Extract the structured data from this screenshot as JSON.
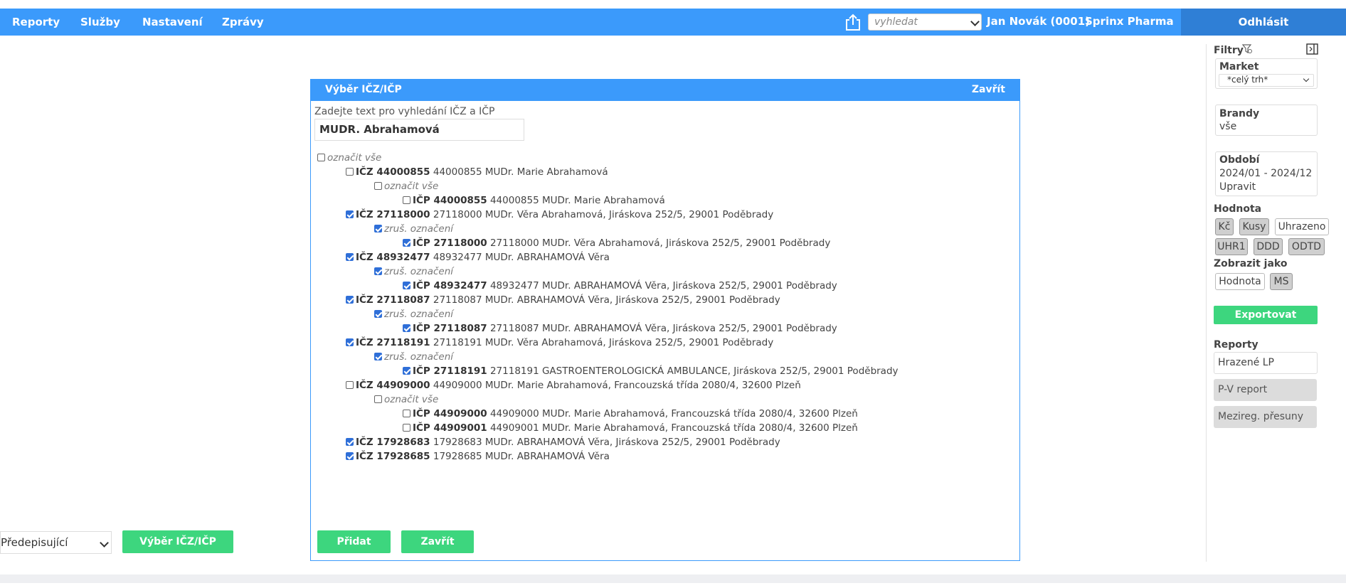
{
  "topbar": {
    "nav": [
      "Reporty",
      "Služby",
      "Nastavení",
      "Zprávy"
    ],
    "search_placeholder": "vyhledat",
    "user": "Jan Novák (0001)",
    "company": "Sprinx Pharma",
    "logout": "Odhlásit"
  },
  "modal": {
    "title": "Výběr IČZ/IČP",
    "close_link": "Zavřít",
    "search_label": "Zadejte text pro vyhledání IČZ a IČP",
    "search_value": "MUDR. Abrahamová",
    "select_all": "označit vše",
    "tree": [
      {
        "level": 1,
        "kind": "item",
        "checked": false,
        "code": "IČZ 44000855",
        "text": "44000855 MUDr. Marie Abrahamová"
      },
      {
        "level": 2,
        "kind": "mark",
        "checked": false,
        "text": "označit vše"
      },
      {
        "level": 3,
        "kind": "item",
        "checked": false,
        "code": "IČP 44000855",
        "text": "44000855 MUDr. Marie Abrahamová"
      },
      {
        "level": 1,
        "kind": "item",
        "checked": true,
        "code": "IČZ 27118000",
        "text": "27118000 MUDr. Věra Abrahamová, Jiráskova 252/5, 29001 Poděbrady"
      },
      {
        "level": 2,
        "kind": "mark",
        "checked": true,
        "text": "zruš. označení"
      },
      {
        "level": 3,
        "kind": "item",
        "checked": true,
        "code": "IČP 27118000",
        "text": "27118000 MUDr. Věra Abrahamová, Jiráskova 252/5, 29001 Poděbrady"
      },
      {
        "level": 1,
        "kind": "item",
        "checked": true,
        "code": "IČZ 48932477",
        "text": "48932477 MUDr. ABRAHAMOVÁ Věra"
      },
      {
        "level": 2,
        "kind": "mark",
        "checked": true,
        "text": "zruš. označení"
      },
      {
        "level": 3,
        "kind": "item",
        "checked": true,
        "code": "IČP 48932477",
        "text": "48932477 MUDr. ABRAHAMOVÁ Věra, Jiráskova 252/5, 29001 Poděbrady"
      },
      {
        "level": 1,
        "kind": "item",
        "checked": true,
        "code": "IČZ 27118087",
        "text": "27118087 MUDr. ABRAHAMOVÁ Věra, Jiráskova 252/5, 29001 Poděbrady"
      },
      {
        "level": 2,
        "kind": "mark",
        "checked": true,
        "text": "zruš. označení"
      },
      {
        "level": 3,
        "kind": "item",
        "checked": true,
        "code": "IČP 27118087",
        "text": "27118087 MUDr. ABRAHAMOVÁ Věra, Jiráskova 252/5, 29001 Poděbrady"
      },
      {
        "level": 1,
        "kind": "item",
        "checked": true,
        "code": "IČZ 27118191",
        "text": "27118191 MUDr. Věra Abrahamová, Jiráskova 252/5, 29001 Poděbrady"
      },
      {
        "level": 2,
        "kind": "mark",
        "checked": true,
        "text": "zruš. označení"
      },
      {
        "level": 3,
        "kind": "item",
        "checked": true,
        "code": "IČP 27118191",
        "text": "27118191 GASTROENTEROLOGICKÁ AMBULANCE, Jiráskova 252/5, 29001 Poděbrady"
      },
      {
        "level": 1,
        "kind": "item",
        "checked": false,
        "code": "IČZ 44909000",
        "text": "44909000 MUDr. Marie Abrahamová, Francouzská třída 2080/4, 32600 Plzeň"
      },
      {
        "level": 2,
        "kind": "mark",
        "checked": false,
        "text": "označit vše"
      },
      {
        "level": 3,
        "kind": "item",
        "checked": false,
        "code": "IČP 44909000",
        "text": "44909000 MUDr. Marie Abrahamová, Francouzská třída 2080/4, 32600 Plzeň"
      },
      {
        "level": 3,
        "kind": "item",
        "checked": false,
        "code": "IČP 44909001",
        "text": "44909001 MUDr. Marie Abrahamová, Francouzská třída 2080/4, 32600 Plzeň"
      },
      {
        "level": 1,
        "kind": "item",
        "checked": true,
        "code": "IČZ 17928683",
        "text": "17928683 MUDr. ABRAHAMOVÁ Věra, Jiráskova 252/5, 29001 Poděbrady"
      },
      {
        "level": 1,
        "kind": "item",
        "checked": true,
        "code": "IČZ 17928685",
        "text": "17928685 MUDr. ABRAHAMOVÁ Věra"
      }
    ],
    "add_button": "Přidat",
    "close_button": "Zavřít"
  },
  "bottom": {
    "select_value": "Předepisující",
    "select_button": "Výběr IČZ/IČP"
  },
  "sidebar": {
    "filters_label": "Filtry",
    "market_label": "Market",
    "market_value": "*celý trh*",
    "brands_label": "Brandy",
    "brands_value": "vše",
    "period_label": "Období",
    "period_value": "2024/01 - 2024/12",
    "period_edit": "Upravit",
    "value_label": "Hodnota",
    "value_pills": [
      {
        "label": "Kč",
        "selected": true
      },
      {
        "label": "Kusy",
        "selected": true
      },
      {
        "label": "Uhrazeno",
        "selected": false
      },
      {
        "label": "UHR1",
        "selected": true
      },
      {
        "label": "DDD",
        "selected": true
      },
      {
        "label": "ODTD",
        "selected": true
      }
    ],
    "display_label": "Zobrazit jako",
    "display_pills": [
      {
        "label": "Hodnota",
        "selected": false
      },
      {
        "label": "MS",
        "selected": true
      }
    ],
    "export_button": "Exportovat",
    "reports_label": "Reporty",
    "reports": [
      "Hrazené LP",
      "P-V report",
      "Mezireg. přesuny"
    ]
  }
}
